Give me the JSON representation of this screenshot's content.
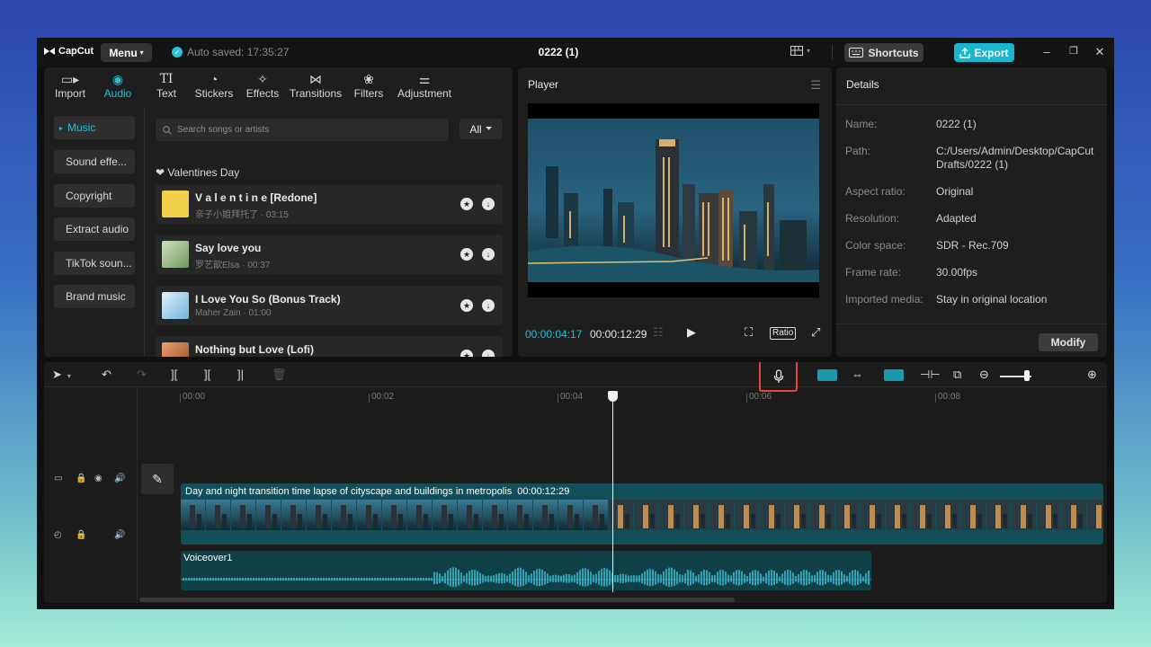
{
  "app": {
    "brand": "CapCut",
    "menu_label": "Menu",
    "autosave": "Auto saved: 17:35:27",
    "title": "0222 (1)",
    "shortcuts_label": "Shortcuts",
    "export_label": "Export"
  },
  "media_tabs": [
    {
      "label": "Import",
      "icon": "import-icon"
    },
    {
      "label": "Audio",
      "icon": "audio-icon",
      "active": true
    },
    {
      "label": "Text",
      "icon": "text-icon"
    },
    {
      "label": "Stickers",
      "icon": "stickers-icon"
    },
    {
      "label": "Effects",
      "icon": "effects-icon"
    },
    {
      "label": "Transitions",
      "icon": "transitions-icon"
    },
    {
      "label": "Filters",
      "icon": "filters-icon"
    },
    {
      "label": "Adjustment",
      "icon": "adjustment-icon"
    }
  ],
  "audio_nav": [
    "Music",
    "Sound effe...",
    "Copyright",
    "Extract audio",
    "TikTok soun...",
    "Brand music"
  ],
  "search": {
    "placeholder": "Search songs or artists",
    "filter_label": "All"
  },
  "section_title": "Valentines Day",
  "songs": [
    {
      "name": "V a l e n t i n e  [Redone]",
      "meta": "亲子小姐拜托了 · 03:15",
      "color": "#f2d04a"
    },
    {
      "name": "Say love you",
      "meta": "罗艺歆Elsa · 00:37",
      "color": "#8fb87a"
    },
    {
      "name": "I Love You So (Bonus Track)",
      "meta": "Maher Zain · 01:00",
      "color": "#8ec9e6"
    },
    {
      "name": "Nothing but Love (Lofi)",
      "meta": "",
      "color": "#c9744a"
    }
  ],
  "player": {
    "title": "Player",
    "current_time": "00:00:04:17",
    "total_time": "00:00:12:29",
    "ratio_label": "Ratio"
  },
  "details": {
    "title": "Details",
    "rows": [
      {
        "k": "Name:",
        "v": "0222 (1)"
      },
      {
        "k": "Path:",
        "v": "C:/Users/Admin/Desktop/CapCut Drafts/0222 (1)"
      },
      {
        "k": "Aspect ratio:",
        "v": "Original"
      },
      {
        "k": "Resolution:",
        "v": "Adapted"
      },
      {
        "k": "Color space:",
        "v": "SDR - Rec.709"
      },
      {
        "k": "Frame rate:",
        "v": "30.00fps"
      },
      {
        "k": "Imported media:",
        "v": "Stay in original location"
      }
    ],
    "modify_label": "Modify"
  },
  "timeline": {
    "ruler": [
      "00:00",
      "00:02",
      "00:04",
      "00:06",
      "00:08"
    ],
    "video_clip": {
      "label": "Day and night transition time lapse of cityscape and buildings in metropolis",
      "duration": "00:00:12:29"
    },
    "audio_clip": {
      "label": "Voiceover1"
    },
    "playhead_seconds": 4.57
  },
  "colors": {
    "accent": "#22c1d6",
    "highlight_border": "#e8443c"
  }
}
